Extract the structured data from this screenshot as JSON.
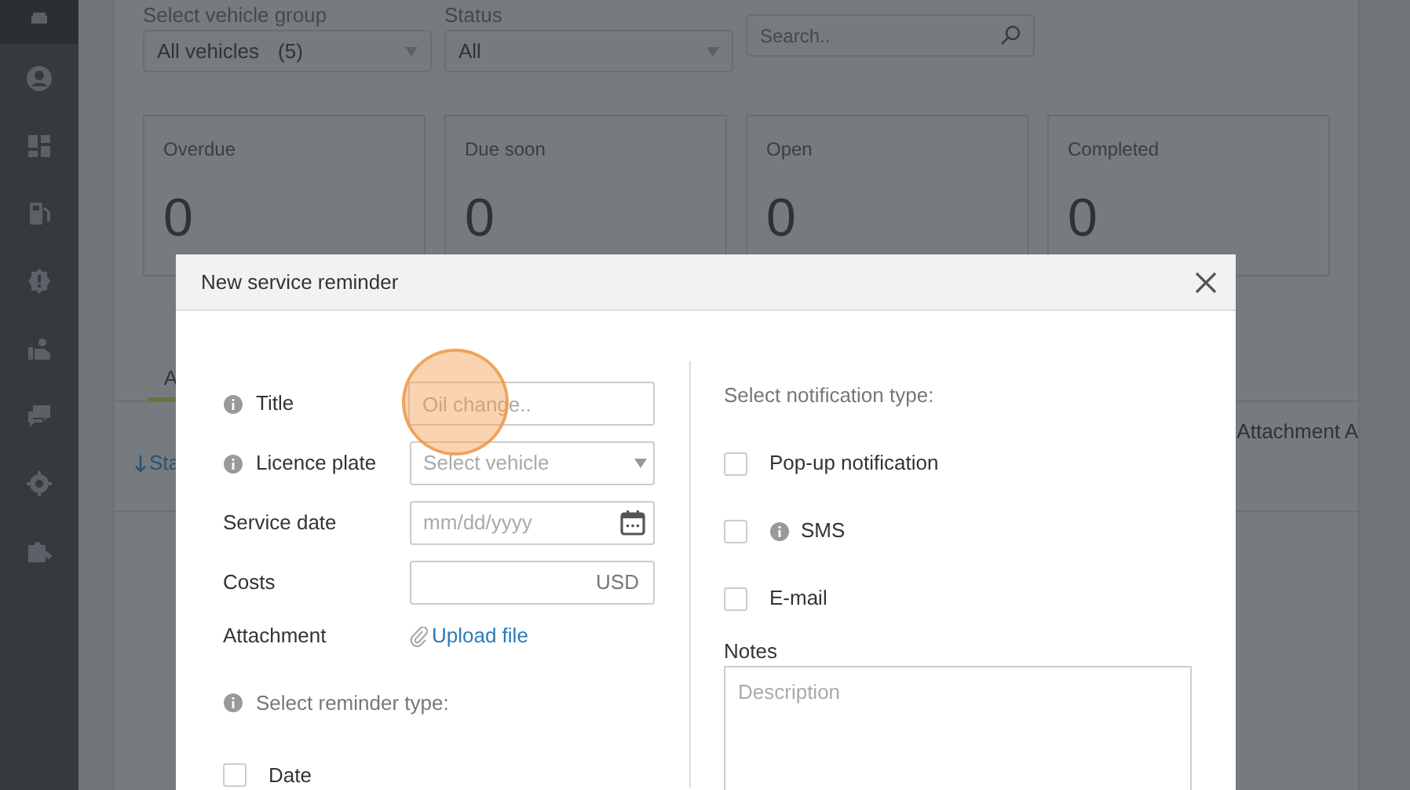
{
  "sidebar": {
    "items": [
      {
        "kind": "car",
        "selected": true
      },
      {
        "kind": "user",
        "selected": false
      },
      {
        "kind": "dashboard",
        "selected": false
      },
      {
        "kind": "fuel",
        "selected": false
      },
      {
        "kind": "badge",
        "selected": false
      },
      {
        "kind": "hand",
        "selected": false
      },
      {
        "kind": "chat",
        "selected": false
      },
      {
        "kind": "gear",
        "selected": false
      },
      {
        "kind": "puzzle",
        "selected": false
      }
    ]
  },
  "filters": [
    {
      "kind": "select",
      "label": "Select vehicle group",
      "value": "All vehicles",
      "count": "(5)"
    },
    {
      "kind": "select",
      "label": "Status",
      "value": "All"
    },
    {
      "kind": "search",
      "placeholder": "Search.."
    }
  ],
  "stats": [
    {
      "label": "Overdue",
      "value": "0"
    },
    {
      "label": "Due soon",
      "value": "0"
    },
    {
      "label": "Open",
      "value": "0"
    },
    {
      "label": "Completed",
      "value": "0"
    }
  ],
  "tabs": [
    {
      "label": "A",
      "selected": true
    }
  ],
  "list_header": {
    "left": "Sta",
    "right": "Attachment A"
  },
  "modal": {
    "title": "New service reminder",
    "fields": [
      {
        "kind": "text",
        "label": "Title",
        "info": true,
        "placeholder": "Oil change..",
        "highlighted": true
      },
      {
        "kind": "select",
        "label": "Licence plate",
        "info": true,
        "placeholder": "Select vehicle",
        "highlighted": false
      },
      {
        "kind": "date",
        "label": "Service date",
        "info": false,
        "placeholder": "mm/dd/yyyy",
        "highlighted": false
      },
      {
        "kind": "currency",
        "label": "Costs",
        "info": false,
        "suffix": "USD",
        "highlighted": false
      },
      {
        "kind": "upload",
        "label": "Attachment",
        "info": false,
        "link": "Upload file",
        "highlighted": false
      }
    ],
    "reminder_type": {
      "label": "Select reminder type:",
      "info": true,
      "options": [
        {
          "label": "Date",
          "info": false,
          "checked": false
        }
      ]
    },
    "notification_type": {
      "label": "Select notification type:",
      "options": [
        {
          "label": "Pop-up notification",
          "info": false,
          "checked": false
        },
        {
          "label": "SMS",
          "info": true,
          "checked": false
        },
        {
          "label": "E-mail",
          "info": false,
          "checked": false
        }
      ]
    },
    "notes": {
      "label": "Notes",
      "placeholder": "Description"
    }
  }
}
